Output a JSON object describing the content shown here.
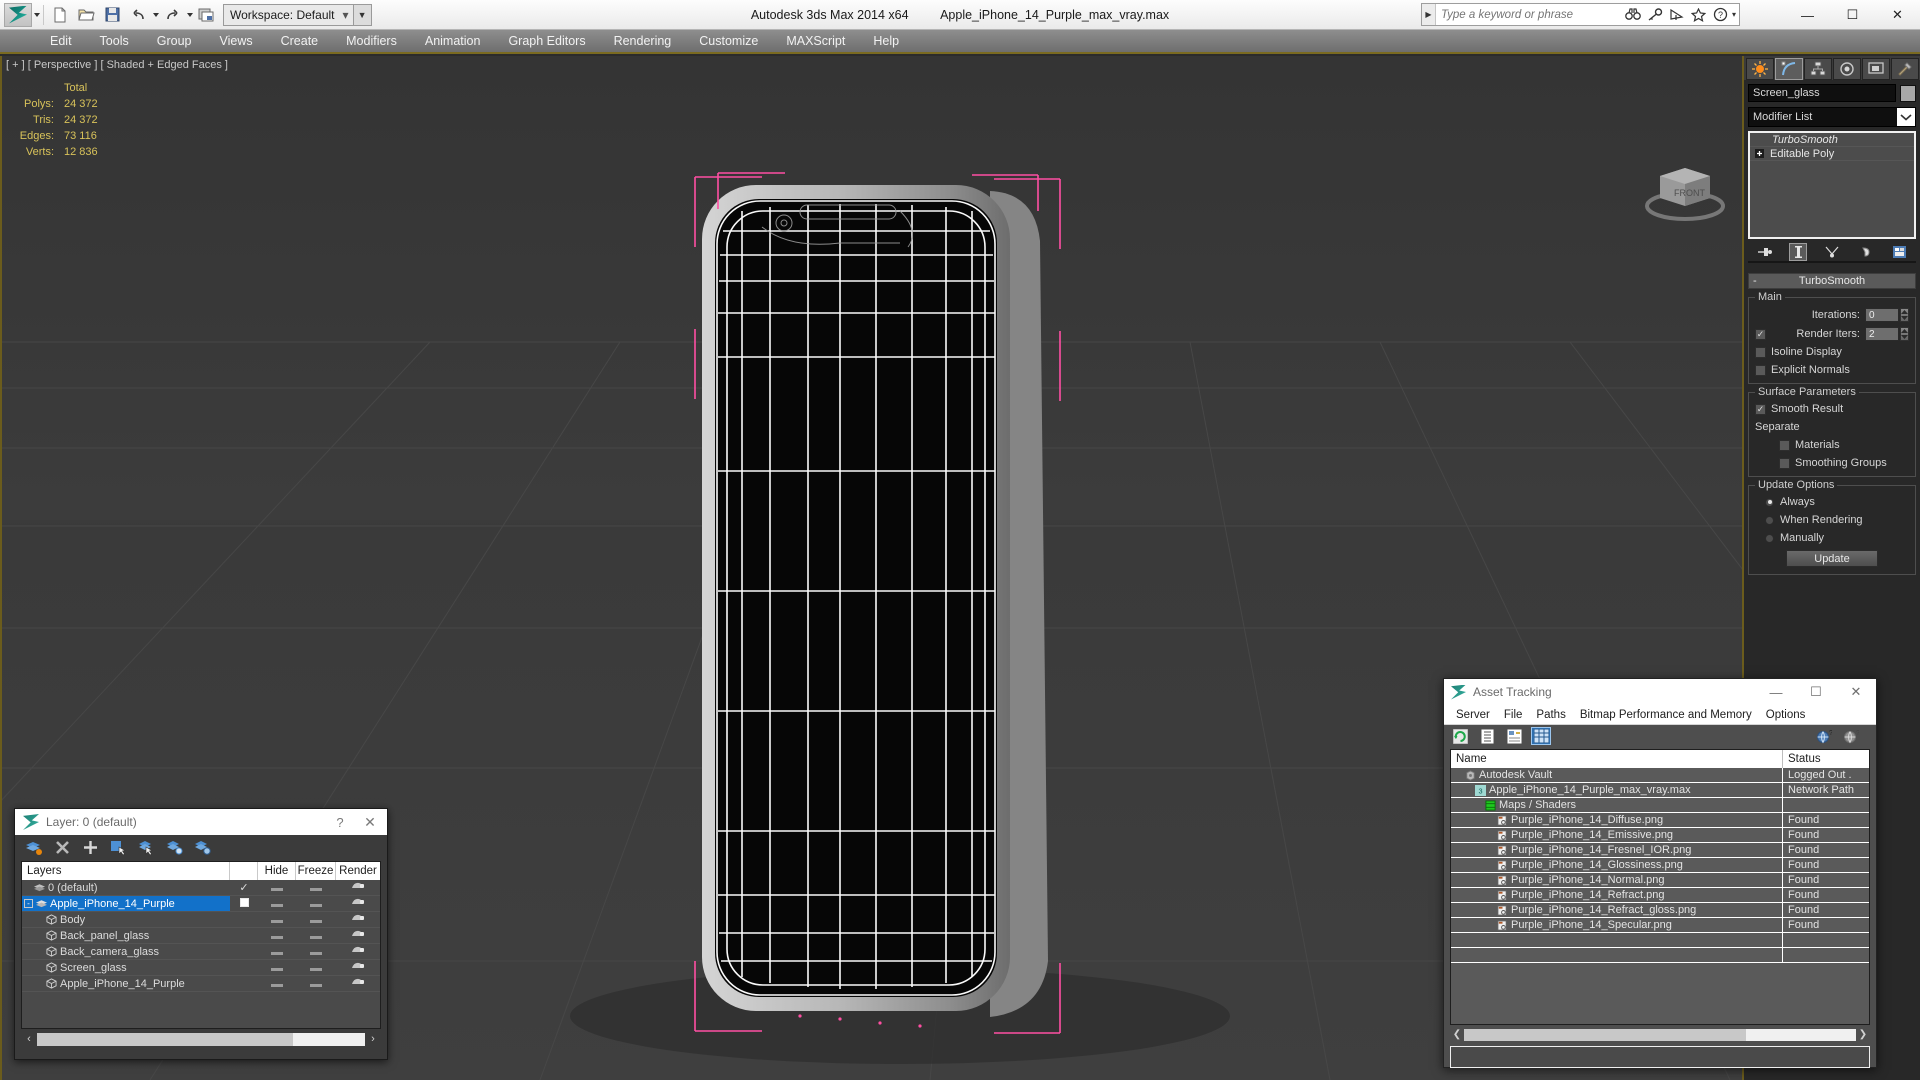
{
  "titlebar": {
    "app_title": "Autodesk 3ds Max  2014 x64",
    "file_title": "Apple_iPhone_14_Purple_max_vray.max",
    "workspace_label": "Workspace: Default",
    "search_placeholder": "Type a keyword or phrase",
    "quick_access": [
      "new-icon",
      "open-icon",
      "save-icon",
      "undo-icon",
      "redo-icon",
      "set-project-icon"
    ],
    "info_icons": [
      "binoculars-icon",
      "key-icon",
      "satellite-icon",
      "star-icon",
      "help-icon"
    ],
    "window_buttons": [
      "minimize",
      "maximize",
      "close"
    ]
  },
  "menubar": {
    "items": [
      "Edit",
      "Tools",
      "Group",
      "Views",
      "Create",
      "Modifiers",
      "Animation",
      "Graph Editors",
      "Rendering",
      "Customize",
      "MAXScript",
      "Help"
    ]
  },
  "viewport": {
    "label": "[ + ] [ Perspective ] [ Shaded + Edged Faces ]",
    "viewcube_face": "FRONT",
    "stats": {
      "header": "Total",
      "rows": [
        {
          "label": "Polys:",
          "value": "24 372"
        },
        {
          "label": "Tris:",
          "value": "24 372"
        },
        {
          "label": "Edges:",
          "value": "73 116"
        },
        {
          "label": "Verts:",
          "value": "12 836"
        }
      ]
    },
    "colors": {
      "background": "#3a3a3a",
      "wireframe": "#ffffff",
      "selection_bracket": "#ff4fa3",
      "grid_line": "#4a4a4a",
      "stats_text": "#d8c25a"
    }
  },
  "command_panel": {
    "tabs": [
      "create-tab-icon",
      "modify-tab-icon",
      "hierarchy-tab-icon",
      "motion-tab-icon",
      "display-tab-icon",
      "utilities-tab-icon"
    ],
    "selected_tab_index": 1,
    "object_name": "Screen_glass",
    "modifier_list_label": "Modifier List",
    "stack": [
      {
        "label": "TurboSmooth",
        "italic": true,
        "icon": "lightbulb-icon"
      },
      {
        "label": "Editable Poly",
        "italic": false,
        "icon": "plus-box-icon"
      }
    ],
    "stack_buttons": [
      "pin-stack-icon",
      "show-end-result-icon",
      "make-unique-icon",
      "remove-modifier-icon",
      "configure-sets-icon"
    ],
    "rollout": {
      "title": "TurboSmooth",
      "collapse_glyph": "-",
      "groups": [
        {
          "label": "Main",
          "fields": [
            {
              "type": "spinner",
              "label": "Iterations:",
              "value": "0",
              "checkbox": null
            },
            {
              "type": "spinner",
              "label": "Render Iters:",
              "value": "2",
              "checkbox": true
            }
          ],
          "checks": [
            {
              "label": "Isoline Display",
              "checked": false
            },
            {
              "label": "Explicit Normals",
              "checked": false
            }
          ]
        },
        {
          "label": "Surface Parameters",
          "checks": [
            {
              "label": "Smooth Result",
              "checked": true
            },
            {
              "label": "Separate",
              "checked": null
            },
            {
              "label": "Materials",
              "checked": false,
              "indent": true
            },
            {
              "label": "Smoothing Groups",
              "checked": false,
              "indent": true
            }
          ]
        },
        {
          "label": "Update Options",
          "radios": [
            {
              "label": "Always",
              "selected": true
            },
            {
              "label": "When Rendering",
              "selected": false
            },
            {
              "label": "Manually",
              "selected": false
            }
          ],
          "button": "Update"
        }
      ]
    }
  },
  "layer_dialog": {
    "title": "Layer: 0 (default)",
    "help_glyph": "?",
    "close_glyph": "✕",
    "toolbar": [
      "create-new-layer-icon",
      "delete-layer-icon",
      "add-selection-icon",
      "select-objects-icon",
      "select-highlighted-icon",
      "highlight-selected-icon",
      "layer-properties-icon"
    ],
    "columns": [
      "Layers",
      "",
      "Hide",
      "Freeze",
      "Render"
    ],
    "rows": [
      {
        "name": "0 (default)",
        "indent": 0,
        "icon": "layer-icon",
        "current": "check",
        "hide": "dash",
        "freeze": "dash",
        "render": "render-icon",
        "selected": false,
        "expander": ""
      },
      {
        "name": "Apple_iPhone_14_Purple",
        "indent": 0,
        "icon": "layer-icon",
        "current": "box",
        "hide": "dash",
        "freeze": "dash",
        "render": "render-icon",
        "selected": true,
        "expander": "-"
      },
      {
        "name": "Body",
        "indent": 1,
        "icon": "object-icon",
        "current": "",
        "hide": "dash",
        "freeze": "dash",
        "render": "render-icon",
        "selected": false,
        "expander": ""
      },
      {
        "name": "Back_panel_glass",
        "indent": 1,
        "icon": "object-icon",
        "current": "",
        "hide": "dash",
        "freeze": "dash",
        "render": "render-icon",
        "selected": false,
        "expander": ""
      },
      {
        "name": "Back_camera_glass",
        "indent": 1,
        "icon": "object-icon",
        "current": "",
        "hide": "dash",
        "freeze": "dash",
        "render": "render-icon",
        "selected": false,
        "expander": ""
      },
      {
        "name": "Screen_glass",
        "indent": 1,
        "icon": "object-icon",
        "current": "",
        "hide": "dash",
        "freeze": "dash",
        "render": "render-icon",
        "selected": false,
        "expander": ""
      },
      {
        "name": "Apple_iPhone_14_Purple",
        "indent": 1,
        "icon": "object-icon",
        "current": "",
        "hide": "dash",
        "freeze": "dash",
        "render": "render-icon",
        "selected": false,
        "expander": ""
      }
    ],
    "scroll_left_glyph": "‹",
    "scroll_right_glyph": "›"
  },
  "asset_tracking": {
    "title": "Asset Tracking",
    "window_buttons": [
      "—",
      "☐",
      "✕"
    ],
    "menu": [
      "Server",
      "File",
      "Paths",
      "Bitmap Performance and Memory",
      "Options"
    ],
    "toolbar": [
      "refresh-icon",
      "list-view-icon",
      "detail-view-icon",
      "grid-view-icon"
    ],
    "toolbar_right": [
      "help-globe-icon",
      "help-icon"
    ],
    "selected_toolbar_index": 3,
    "columns": [
      "Name",
      "Status"
    ],
    "rows": [
      {
        "name": "Autodesk Vault",
        "status": "Logged Out .",
        "indent": 0,
        "icon": "vault-icon"
      },
      {
        "name": "Apple_iPhone_14_Purple_max_vray.max",
        "status": "Network Path",
        "indent": 1,
        "icon": "max-file-icon"
      },
      {
        "name": "Maps / Shaders",
        "status": "",
        "indent": 2,
        "icon": "maps-icon"
      },
      {
        "name": "Purple_iPhone_14_Diffuse.png",
        "status": "Found",
        "indent": 3,
        "icon": "bitmap-icon"
      },
      {
        "name": "Purple_iPhone_14_Emissive.png",
        "status": "Found",
        "indent": 3,
        "icon": "bitmap-icon"
      },
      {
        "name": "Purple_iPhone_14_Fresnel_IOR.png",
        "status": "Found",
        "indent": 3,
        "icon": "bitmap-icon"
      },
      {
        "name": "Purple_iPhone_14_Glossiness.png",
        "status": "Found",
        "indent": 3,
        "icon": "bitmap-icon"
      },
      {
        "name": "Purple_iPhone_14_Normal.png",
        "status": "Found",
        "indent": 3,
        "icon": "bitmap-icon"
      },
      {
        "name": "Purple_iPhone_14_Refract.png",
        "status": "Found",
        "indent": 3,
        "icon": "bitmap-icon"
      },
      {
        "name": "Purple_iPhone_14_Refract_gloss.png",
        "status": "Found",
        "indent": 3,
        "icon": "bitmap-icon"
      },
      {
        "name": "Purple_iPhone_14_Specular.png",
        "status": "Found",
        "indent": 3,
        "icon": "bitmap-icon"
      }
    ],
    "scroll_left_glyph": "❮",
    "scroll_right_glyph": "❯"
  }
}
